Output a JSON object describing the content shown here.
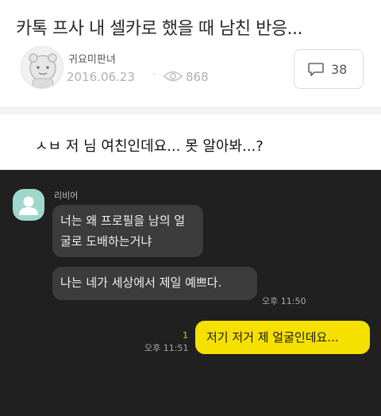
{
  "post": {
    "title": "카톡 프사 내 셀카로 했을 때 남친 반응...",
    "author": "귀요미판녀",
    "date": "2016.06.23",
    "separator": "·",
    "views": "868",
    "comment_count": "38",
    "caption": "ㅅㅂ 저 님 여친인데요... 못 알아봐...?"
  },
  "chat": {
    "sender_name": "리비어",
    "messages_received": [
      "너는 왜 프로필을 남의 얼굴로 도배하는거냐",
      "나는 네가 세상에서 제일 예쁘다."
    ],
    "received_time": "오후 11:50",
    "sent_message": "저기 저거 제 얼굴인데요...",
    "sent_time": "오후 11:51",
    "unread_count": "1"
  },
  "colors": {
    "chat_background": "#202020",
    "received_bubble": "#3c3c3c",
    "sent_bubble": "#f5e000",
    "unread_indicator": "#e6c200",
    "default_avatar": "#9fd7cc"
  },
  "icons": {
    "author_avatar": "cartoon-character-icon",
    "views": "eye-icon",
    "comments": "speech-bubble-icon",
    "chat_avatar": "default-profile-icon"
  }
}
